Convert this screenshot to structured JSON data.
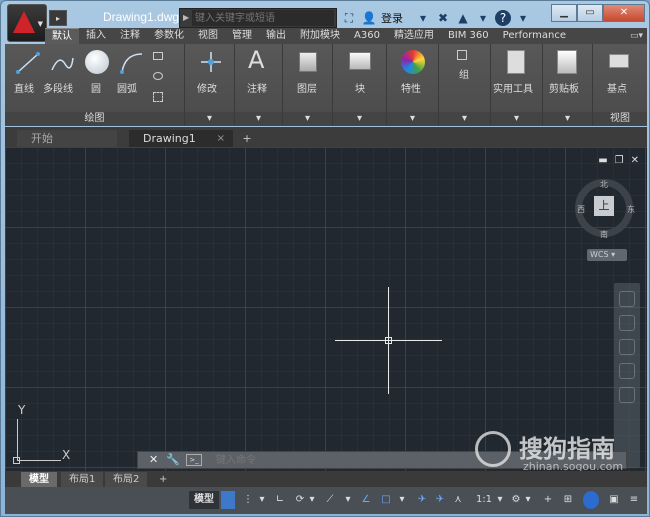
{
  "app": {
    "title": "Drawing1.dwg",
    "logo": "autocad-a-logo",
    "qa_arrow": "▸"
  },
  "search": {
    "placeholder": "键入关键字或短语"
  },
  "toolbar": {
    "login_label": "登录",
    "help": "?"
  },
  "ribbon_tabs": [
    "默认",
    "插入",
    "注释",
    "参数化",
    "视图",
    "管理",
    "输出",
    "附加模块",
    "A360",
    "精选应用",
    "BIM 360",
    "Performance"
  ],
  "ribbon": {
    "draw": {
      "line": "直线",
      "polyline": "多段线",
      "circle": "圆",
      "arc": "圆弧",
      "panel": "绘图"
    },
    "modify": "修改",
    "annotation": "注释",
    "layers": "图层",
    "block": "块",
    "properties": "特性",
    "group": "组",
    "utilities": "实用工具",
    "clipboard": "剪贴板",
    "view": {
      "basepoint": "基点",
      "panel": "视图"
    }
  },
  "file_tabs": {
    "start": "开始",
    "drawing": "Drawing1",
    "close": "×",
    "add": "+"
  },
  "viewcube": {
    "top": "上",
    "north": "北",
    "south": "南",
    "east": "东",
    "west": "西",
    "wcs": "WCS"
  },
  "ucs": {
    "x": "X",
    "y": "Y"
  },
  "command": {
    "placeholder": "键入命令"
  },
  "layout_tabs": [
    "模型",
    "布局1",
    "布局2"
  ],
  "layout_add": "+",
  "status": {
    "model": "模型",
    "scale": "1:1"
  },
  "watermark": {
    "brand": "搜狗指南",
    "url": "zhinan.sogou.com"
  },
  "colors": {
    "canvas": "#212830",
    "ribbon": "#535353",
    "accent_red": "#d0242b",
    "title_bar": "#9ec0de"
  }
}
